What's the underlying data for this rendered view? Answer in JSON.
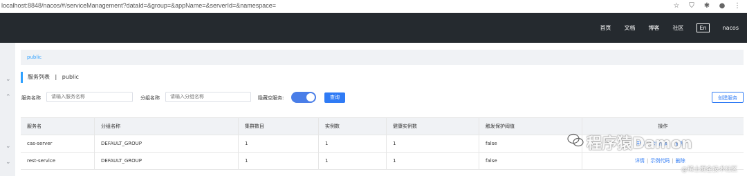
{
  "browser": {
    "url": "localhost:8848/nacos/#/serviceManagement?dataId=&group=&appName=&serverId=&namespace="
  },
  "topnav": {
    "items": [
      "首页",
      "文档",
      "博客",
      "社区"
    ],
    "lang": "En",
    "user": "nacos"
  },
  "breadcrumb": {
    "namespace": "public"
  },
  "title": {
    "text": "服务列表",
    "sep": "|",
    "namespace": "public"
  },
  "filters": {
    "service_name_label": "服务名称",
    "service_name_placeholder": "请输入服务名称",
    "group_name_label": "分组名称",
    "group_name_placeholder": "请输入分组名称",
    "hide_empty_label": "隐藏空服务:",
    "hide_empty_on": true,
    "search_label": "查询",
    "create_label": "创建服务"
  },
  "table": {
    "headers": [
      "服务名",
      "分组名称",
      "集群数目",
      "实例数",
      "健康实例数",
      "触发保护阈值",
      "操作"
    ],
    "rows": [
      {
        "name": "cas-server",
        "group": "DEFAULT_GROUP",
        "clusters": "1",
        "instances": "1",
        "healthy": "1",
        "threshold": "false"
      },
      {
        "name": "rest-service",
        "group": "DEFAULT_GROUP",
        "clusters": "1",
        "instances": "1",
        "healthy": "1",
        "threshold": "false"
      }
    ],
    "ops": {
      "detail": "详情",
      "sample": "示例代码",
      "delete": "删除",
      "sep": "|"
    }
  },
  "watermark": {
    "text": "程序猿Damon",
    "footer": "@稀土掘金技术社区"
  },
  "colors": {
    "accent": "#2f7bf5",
    "nav_bg": "#252a2f",
    "link": "#2ea0ff"
  }
}
